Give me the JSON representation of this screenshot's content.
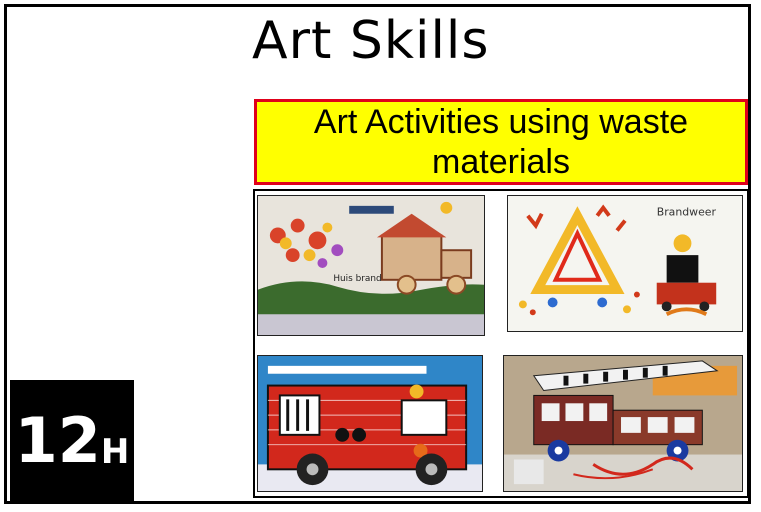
{
  "slide": {
    "title": "Art Skills",
    "banner_text": "Art Activities using waste materials",
    "badge_number": "12",
    "badge_suffix": "H"
  },
  "photos": [
    {
      "id": "photo-collage-house",
      "caption": "Huis brand"
    },
    {
      "id": "photo-fire-triangle",
      "caption": "Brandweer"
    },
    {
      "id": "photo-fire-truck-mosaic"
    },
    {
      "id": "photo-fire-truck-model"
    }
  ],
  "colors": {
    "banner_bg": "#ffff00",
    "banner_border": "#e0001a",
    "badge_bg": "#000000"
  }
}
